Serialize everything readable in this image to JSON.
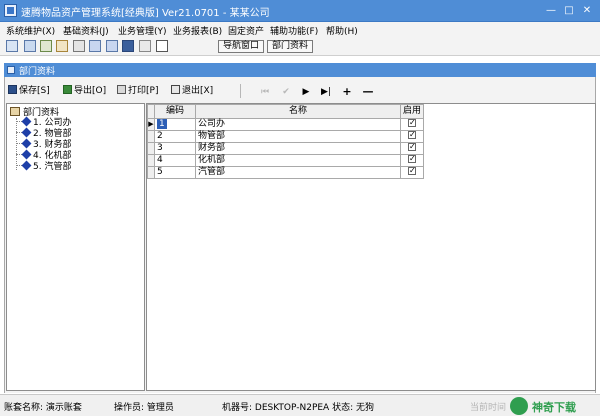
{
  "window": {
    "title": "速腾物品资产管理系统[经典版] Ver21.0701 - 某某公司",
    "controls": {
      "minimize": "—",
      "maximize": "□",
      "close": "✕"
    }
  },
  "menu": [
    "系统维护(X)",
    "基础资料(J)",
    "业务管理(Y)",
    "业务报表(B)",
    "固定资产",
    "辅助功能(F)",
    "帮助(H)"
  ],
  "icon_toolbar": {
    "icons": [
      "grid-icon",
      "list-icon",
      "doc-icon",
      "folder-icon",
      "return-icon",
      "report-icon",
      "card-icon",
      "save-icon",
      "printer-icon",
      "exit-icon"
    ],
    "nav_window_label": "导航窗口",
    "dept_info_label": "部门资料"
  },
  "inner_window": {
    "title": "部门资料"
  },
  "actions": {
    "save": "保存[S]",
    "export": "导出[O]",
    "print": "打印[P]",
    "exit": "退出[X]",
    "nav": {
      "first": "⏮",
      "prev": "✔",
      "next": "▶",
      "last": "▶|",
      "add": "+",
      "remove": "—"
    }
  },
  "tree": {
    "root": "部门资料",
    "children": [
      "1. 公司办",
      "2. 物管部",
      "3. 财务部",
      "4. 化机部",
      "5. 汽管部"
    ]
  },
  "grid": {
    "headers": {
      "code": "编码",
      "name": "名称",
      "enabled": "启用"
    },
    "rows": [
      {
        "code": "1",
        "name": "公司办",
        "enabled": true,
        "selected": true
      },
      {
        "code": "2",
        "name": "物管部",
        "enabled": true
      },
      {
        "code": "3",
        "name": "财务部",
        "enabled": true
      },
      {
        "code": "4",
        "name": "化机部",
        "enabled": true
      },
      {
        "code": "5",
        "name": "汽管部",
        "enabled": true
      }
    ]
  },
  "statusbar": {
    "account": "账套名称: 演示账套",
    "operator": "操作员: 管理员",
    "machine": "机器号: DESKTOP-N2PEA 状态: 无狗",
    "time_faded": "当前时间"
  },
  "watermark": {
    "text": "神奇下载"
  },
  "colors": {
    "title_bar": "#4f8dd6",
    "selection": "#2d5fb6",
    "tree_diamond": "#1e3fa8",
    "watermark": "#2f9e4f"
  }
}
